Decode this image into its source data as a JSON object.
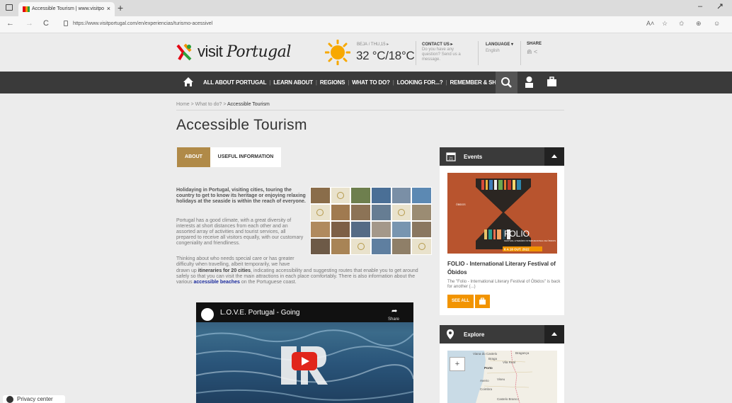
{
  "browser": {
    "tab_title": "Accessible Tourism | www.visitpo",
    "tab_close": "×",
    "new_tab": "+",
    "url": "https://www.visitportugal.com/en/experiencias/turismo-acessivel",
    "back": "←",
    "forward": "→",
    "reload": "C",
    "minimize": "–",
    "tools": [
      "A˄",
      "☆",
      "✩",
      "⊕",
      "☺"
    ]
  },
  "header": {
    "logo_text_a": "visit ",
    "logo_text_b": "Portugal",
    "weather_city": "BEJA",
    "weather_date": "/ THU,15 ▸",
    "weather_temp": "32 °C/18°C",
    "contact_title": "CONTACT US ▸",
    "contact_text": "Do you have any question? Send us a message.",
    "language_title": "LANGUAGE ▾",
    "language_value": "English",
    "share_title": "SHARE",
    "share_icons": "⋒ <"
  },
  "nav": {
    "items": [
      "ALL ABOUT PORTUGAL",
      "LEARN ABOUT",
      "REGIONS",
      "WHAT TO DO?",
      "LOOKING FOR...?",
      "REMEMBER & SHARE"
    ],
    "separator": "|",
    "dark_color": "#3a3a3a"
  },
  "breadcrumb": {
    "home": "Home",
    "sep": " > ",
    "what": "What to do?",
    "current": "Accessible Tourism"
  },
  "page": {
    "title": "Accessible Tourism",
    "tabs": [
      "ABOUT",
      "USEFUL INFORMATION"
    ],
    "intro": "Holidaying in Portugal, visiting cities, touring the country to get to know its heritage or enjoying relaxing holidays at the seaside is within the reach of everyone.",
    "para1": "Portugal has a good climate, with a great diversity of interests at short distances from each other and an assorted array of activities and tourist services, all prepared to receive all visitors equally, with our customary congeniality and friendliness.",
    "para2_a": "Thinking about who needs special care or has greater difficulty when travelling, albeit temporarily, we have",
    "para2_b": "drawn up ",
    "para2_bold": "itineraries for 20 cities",
    "para2_c": ", indicating accessibility and suggesting routes that enable you to get around safely so that you can visit the main attractions in each place comfortably. There is also information about the various ",
    "para2_link": "accessible beaches",
    "para2_d": " on the Portuguese coast.",
    "accent_color": "#b08a48"
  },
  "video": {
    "title": "L.O.V.E. Portugal - Going",
    "share": "Share"
  },
  "events": {
    "title": "Events",
    "calendar_day": "21",
    "poster_name": "FOLIO",
    "poster_sub": "FESTIVAL LITERÁRIO INTERNACIONAL DE ÓBIDOS",
    "poster_dates": "6 A 16 OUT. 2022",
    "name": "FOLIO - International Literary Festival of Óbidos",
    "description": "The \"Folio - International Literary Festival of Óbidos\" is back for another (...)",
    "see_all": "SEE ALL",
    "button_color": "#f29400"
  },
  "explore": {
    "title": "Explore",
    "zoom_in": "+",
    "map_labels": [
      "Viana do Castelo",
      "Bragança",
      "Braga",
      "Vila Real",
      "Porto",
      "Aveiro",
      "Viseu",
      "Coimbra",
      "Castelo Branco"
    ]
  },
  "privacy": {
    "label": "Privacy center"
  }
}
